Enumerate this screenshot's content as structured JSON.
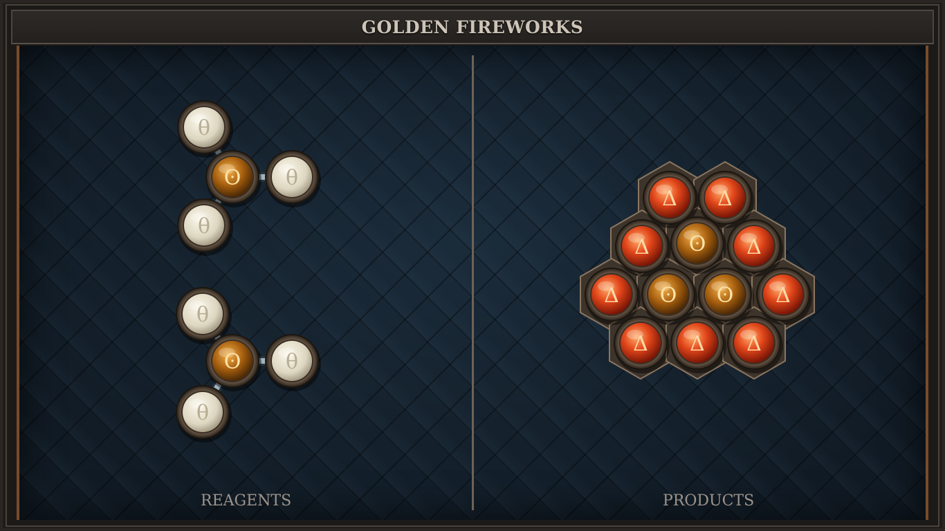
{
  "title": "GOLDEN FIREWORKS",
  "panels": {
    "reagents_label": "REAGENTS",
    "products_label": "PRODUCTS"
  },
  "symbols": {
    "salt": "θ",
    "gold": "ʘ",
    "fire": "Δ"
  },
  "colors": {
    "salt": "#e8e2cf",
    "gold": "#c47a1c",
    "fire": "#e0451a",
    "frame_accent": "#7a4b2a",
    "board": "#15222e"
  },
  "reagents": [
    {
      "name": "reagent-molecule-1",
      "atoms": [
        "salt",
        "gold",
        "salt",
        "salt"
      ]
    },
    {
      "name": "reagent-molecule-2",
      "atoms": [
        "salt",
        "gold",
        "salt",
        "salt"
      ]
    }
  ],
  "products": [
    {
      "name": "product-molecule",
      "atoms": [
        "fire",
        "fire",
        "fire",
        "gold",
        "fire",
        "fire",
        "gold",
        "gold",
        "fire",
        "fire",
        "fire",
        "fire"
      ]
    }
  ]
}
